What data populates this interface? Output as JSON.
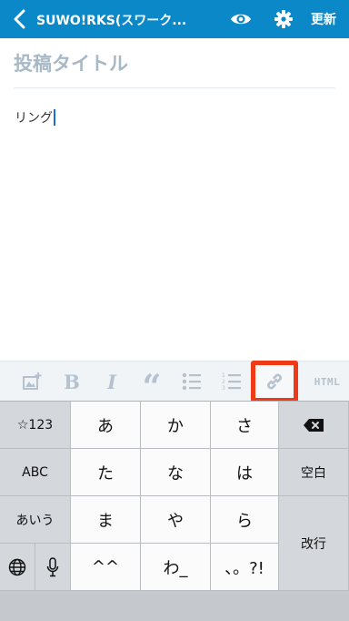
{
  "header": {
    "back_icon": "chevron-left-icon",
    "title": "SUWO!RKS(スワーク...",
    "preview_icon": "eye-icon",
    "settings_icon": "gear-icon",
    "update_label": "更新",
    "background_color": "#0a88c8"
  },
  "editor": {
    "title_placeholder": "投稿タイトル",
    "body_text": "リング"
  },
  "format_toolbar": {
    "image_icon": "image-add-icon",
    "bold_label": "B",
    "italic_label": "I",
    "quote_label": "“",
    "bullet_list_icon": "bulleted-list-icon",
    "numbered_list_icon": "numbered-list-icon",
    "link_icon": "link-icon",
    "html_label": "HTML",
    "highlight_color": "#f03a17"
  },
  "keyboard": {
    "row1": [
      "☆123",
      "あ",
      "か",
      "さ"
    ],
    "row2": [
      "ABC",
      "た",
      "な",
      "は",
      "空白"
    ],
    "row3": [
      "あいう",
      "ま",
      "や",
      "ら",
      "改行"
    ],
    "row4": [
      "^^",
      "わ_",
      "、。?!"
    ],
    "backspace_icon": "backspace-icon",
    "globe_icon": "globe-icon",
    "mic_icon": "microphone-icon"
  }
}
